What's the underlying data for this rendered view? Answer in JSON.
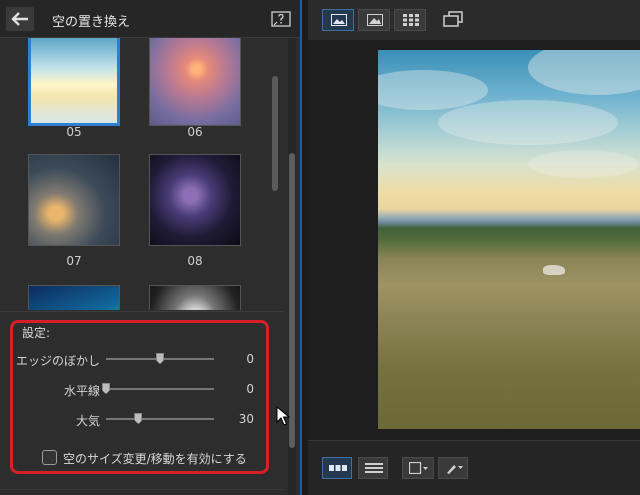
{
  "panel": {
    "title": "空の置き換え",
    "back_icon": "arrow-left-icon",
    "help_icon": "help-panel-icon"
  },
  "thumbnails": [
    {
      "label": "05",
      "selected": true
    },
    {
      "label": "06",
      "selected": false
    },
    {
      "label": "07",
      "selected": false
    },
    {
      "label": "08",
      "selected": false
    },
    {
      "label": "",
      "selected": false
    },
    {
      "label": "",
      "selected": false
    }
  ],
  "settings": {
    "title": "設定:",
    "edge_blur": {
      "label": "エッジのぼかし",
      "value": "0",
      "fraction": 0.5
    },
    "horizon": {
      "label": "水平線",
      "value": "0",
      "fraction": 0.0
    },
    "atmosphere": {
      "label": "大気",
      "value": "30",
      "fraction": 0.3
    },
    "enable_resize": {
      "label": "空のサイズ変更/移動を有効にする",
      "checked": false
    }
  },
  "toolbar": {
    "view_icons": [
      "single-image-view-icon",
      "image-view-icon",
      "grid-view-icon",
      "compare-view-icon"
    ]
  },
  "colors": {
    "highlight_border": "#d81f26",
    "accent": "#2f7fd0"
  }
}
